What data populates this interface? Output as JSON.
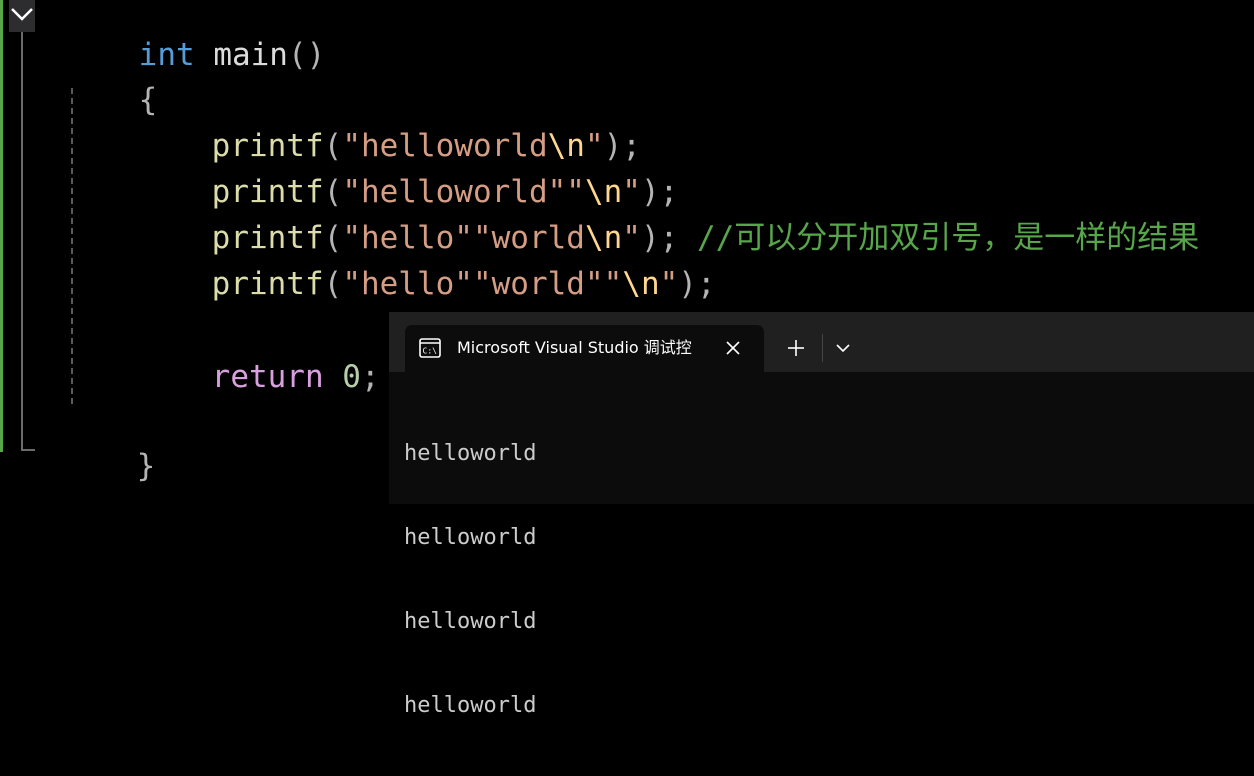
{
  "editor": {
    "lines": {
      "l1": {
        "kw": "int",
        "name": " main",
        "parens": "()"
      },
      "l2": {
        "brace_open": "{"
      },
      "l3": {
        "fn": "printf",
        "open": "(",
        "str1": "\"helloworld",
        "esc": "\\n",
        "str2": "\"",
        "close": ");"
      },
      "l4": {
        "fn": "printf",
        "open": "(",
        "str1": "\"helloworld\"\"",
        "esc": "\\n",
        "str2": "\"",
        "close": ");"
      },
      "l5": {
        "fn": "printf",
        "open": "(",
        "str1": "\"hello\"\"world",
        "esc": "\\n",
        "str2": "\"",
        "close": ");",
        "comment": " //可以分开加双引号，是一样的结果"
      },
      "l6": {
        "fn": "printf",
        "open": "(",
        "str1": "\"hello\"\"world\"\"",
        "esc": "\\n",
        "str2": "\"",
        "close": ");"
      },
      "l8": {
        "ret": "return",
        "num": " 0",
        "semi": ";"
      },
      "l10": {
        "brace_close": "}"
      }
    }
  },
  "terminal": {
    "tab_title": "Microsoft Visual Studio 调试控",
    "tab_icon": "console-icon",
    "close_icon": "close-icon",
    "new_tab_icon": "plus-icon",
    "dropdown_icon": "chevron-down-icon",
    "output": [
      "helloworld",
      "helloworld",
      "helloworld",
      "helloworld"
    ]
  },
  "colors": {
    "keyword": "#569cd6",
    "function": "#dcdcaa",
    "string": "#d69d85",
    "escape": "#ffd68f",
    "comment": "#57a64a",
    "control": "#d8a0df",
    "number": "#b5cea8"
  }
}
